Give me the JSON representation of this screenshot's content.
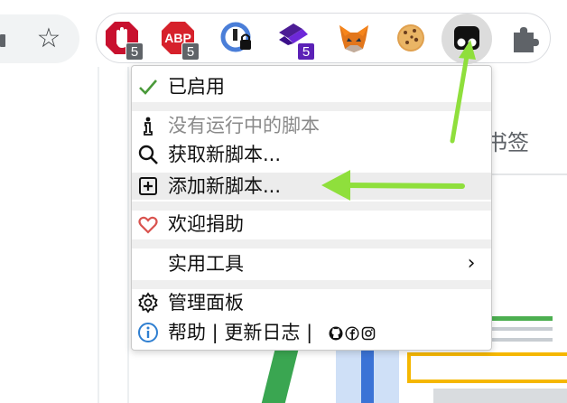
{
  "toolbar": {
    "extensions": [
      {
        "name": "uBlock Origin",
        "badge": "5",
        "badge_color": "#5f6368"
      },
      {
        "name": "AdBlock Plus",
        "badge": "5",
        "badge_color": "#5f6368"
      },
      {
        "name": "Tampermonkey style lock extension",
        "badge": "",
        "badge_color": ""
      },
      {
        "name": "Stacked layers extension",
        "badge": "5",
        "badge_color": "#5b21b6"
      },
      {
        "name": "MetaMask",
        "badge": "",
        "badge_color": ""
      },
      {
        "name": "Cookie extension",
        "badge": "",
        "badge_color": ""
      },
      {
        "name": "Tampermonkey",
        "badge": "",
        "badge_color": ""
      },
      {
        "name": "Extensions",
        "badge": "",
        "badge_color": ""
      }
    ]
  },
  "page": {
    "bookmarks_text": "书签"
  },
  "menu": {
    "enabled_label": "已启用",
    "no_scripts_label": "没有运行中的脚本",
    "get_scripts_label": "获取新脚本...",
    "add_script_label": "添加新脚本...",
    "donate_label": "欢迎捐助",
    "utilities_label": "实用工具",
    "dashboard_label": "管理面板",
    "help_label": "帮助 | 更新日志 |"
  },
  "colors": {
    "accent_green": "#8fdf3c",
    "check_green": "#4a9a3a",
    "heart_red": "#d9534f",
    "info_blue": "#2f7fd1"
  }
}
